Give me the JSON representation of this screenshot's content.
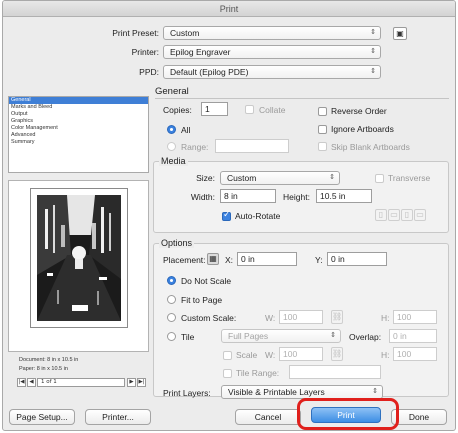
{
  "window": {
    "title": "Print"
  },
  "header": {
    "preset_label": "Print Preset:",
    "preset_value": "Custom",
    "printer_label": "Printer:",
    "printer_value": "Epilog Engraver",
    "ppd_label": "PPD:",
    "ppd_value": "Default (Epilog PDE)"
  },
  "sidebar": {
    "categories": [
      "General",
      "Marks and Bleed",
      "Output",
      "Graphics",
      "Color Management",
      "Advanced",
      "Summary"
    ],
    "selected": "General",
    "document_info": "Document: 8 in x 10.5 in",
    "paper_info": "Paper: 8 in x 10.5 in",
    "page_indicator": "1 of 1"
  },
  "general": {
    "title": "General",
    "copies_label": "Copies:",
    "copies_value": "1",
    "collate_label": "Collate",
    "reverse_label": "Reverse Order",
    "all_label": "All",
    "ignore_label": "Ignore Artboards",
    "range_label": "Range:",
    "skip_label": "Skip Blank Artboards"
  },
  "media": {
    "title": "Media",
    "size_label": "Size:",
    "size_value": "Custom",
    "transverse_label": "Transverse",
    "width_label": "Width:",
    "width_value": "8 in",
    "height_label": "Height:",
    "height_value": "10.5 in",
    "autorotate_label": "Auto-Rotate"
  },
  "options": {
    "title": "Options",
    "placement_label": "Placement:",
    "x_label": "X:",
    "x_value": "0 in",
    "y_label": "Y:",
    "y_value": "0 in",
    "do_not_scale": "Do Not Scale",
    "fit_to_page": "Fit to Page",
    "custom_scale": "Custom Scale:",
    "w_label": "W:",
    "w_value": "100",
    "h_label": "H:",
    "h_value": "100",
    "tile_label": "Tile",
    "tile_select": "Full Pages",
    "overlap_label": "Overlap:",
    "overlap_value": "0 in",
    "scale_label": "Scale",
    "scale_w_label": "W:",
    "scale_w_value": "100",
    "scale_h_label": "H:",
    "scale_h_value": "100",
    "tile_range_label": "Tile Range:",
    "print_layers_label": "Print Layers:",
    "print_layers_value": "Visible & Printable Layers"
  },
  "footer": {
    "page_setup": "Page Setup...",
    "printer": "Printer...",
    "cancel": "Cancel",
    "print": "Print",
    "done": "Done"
  },
  "colors": {
    "accent": "#3b82e0",
    "highlight": "#e0201c",
    "window_bg": "#ececec"
  }
}
